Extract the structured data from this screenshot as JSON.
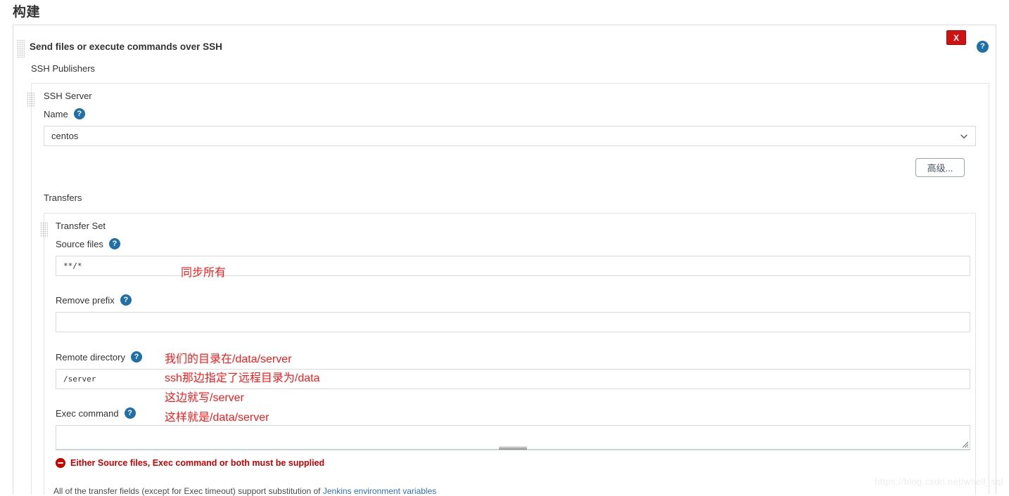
{
  "page": {
    "title": "构建"
  },
  "builder": {
    "block_title": "Send files or execute commands over SSH",
    "close_label": "X",
    "help_label": "?",
    "publishers_label": "SSH Publishers",
    "ssh_server": {
      "section_label": "SSH Server",
      "name_label": "Name",
      "name_value": "centos",
      "name_options": [
        "centos"
      ],
      "advanced_button": "高级..."
    },
    "transfers": {
      "section_label": "Transfers",
      "transfer_set_label": "Transfer Set",
      "source_files_label": "Source files",
      "source_files_value": "**/*",
      "remove_prefix_label": "Remove prefix",
      "remove_prefix_value": "",
      "remote_directory_label": "Remote directory",
      "remote_directory_value": "/server",
      "exec_command_label": "Exec command",
      "exec_command_value": "",
      "error_message": "Either Source files, Exec command or both must be supplied"
    },
    "footnote": {
      "text_before": "All of the transfer fields (except for Exec timeout) support substitution of ",
      "link_text": "Jenkins environment variables"
    }
  },
  "annotations": {
    "source_files_note": "同步所有",
    "remote_dir_line1": "我们的目录在/data/server",
    "remote_dir_line2": "ssh那边指定了远程目录为/data",
    "remote_dir_line3": "这边就写/server",
    "remote_dir_line4": "这样就是/data/server"
  },
  "watermark": {
    "text": "https://blog.csdn.net/whell_sql"
  },
  "colors": {
    "accent_blue": "#1f6fa9",
    "error_red": "#cc0000",
    "close_red": "#cf1111",
    "annotation_red": "#ff1a1a",
    "link_blue": "#2e6fc2"
  }
}
